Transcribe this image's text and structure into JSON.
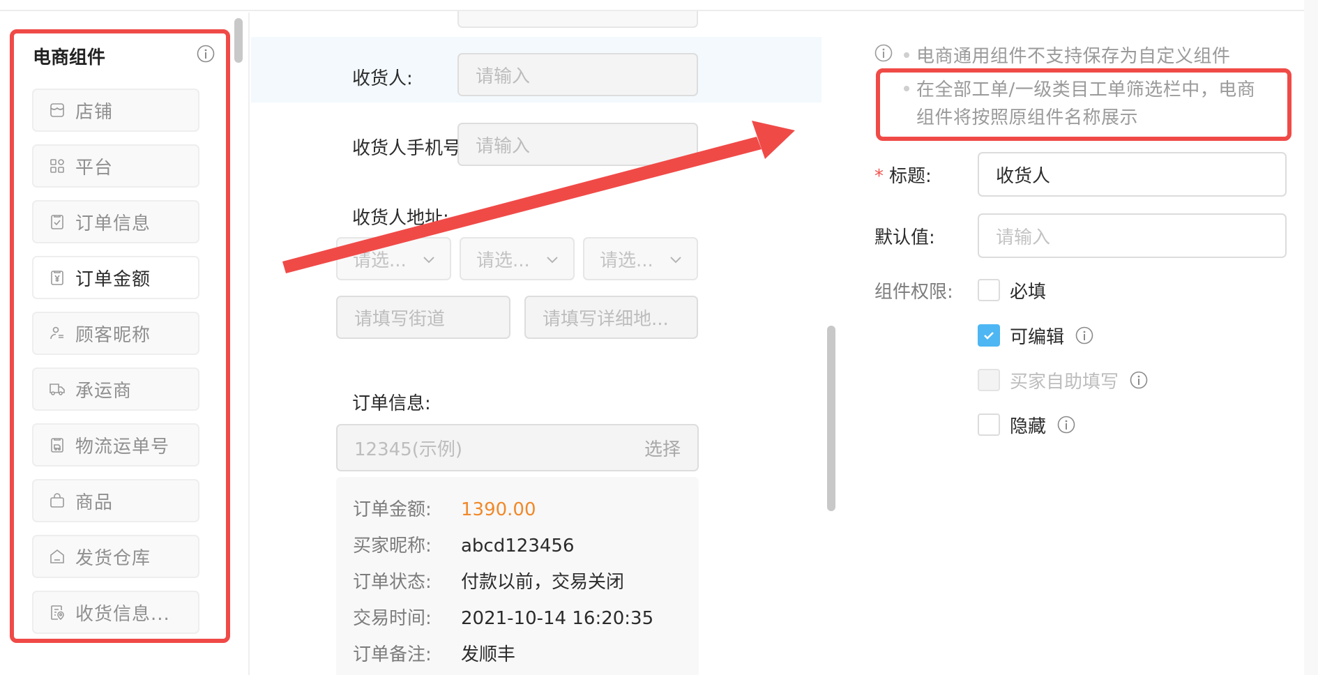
{
  "sidebar": {
    "title": "电商组件",
    "info_icon": "info-circle-icon",
    "items": [
      {
        "label": "店铺",
        "icon": "store-icon",
        "active": false
      },
      {
        "label": "平台",
        "icon": "grid-icon",
        "active": false
      },
      {
        "label": "订单信息",
        "icon": "clipboard-check-icon",
        "active": false
      },
      {
        "label": "订单金额",
        "icon": "yuan-receipt-icon",
        "active": true
      },
      {
        "label": "顾客昵称",
        "icon": "user-list-icon",
        "active": false
      },
      {
        "label": "承运商",
        "icon": "truck-icon",
        "active": false
      },
      {
        "label": "物流运单号",
        "icon": "delivery-doc-icon",
        "active": false
      },
      {
        "label": "商品",
        "icon": "shopping-bag-icon",
        "active": false
      },
      {
        "label": "发货仓库",
        "icon": "warehouse-icon",
        "active": false
      },
      {
        "label": "收货信息...",
        "icon": "address-doc-icon",
        "active": false
      }
    ]
  },
  "preview": {
    "consignee": {
      "label": "收货人:",
      "placeholder": "请输入"
    },
    "consignee_phone": {
      "label": "收货人手机号",
      "placeholder": "请输入"
    },
    "consignee_address": {
      "label": "收货人地址:",
      "selects": [
        "请选...",
        "请选...",
        "请选..."
      ],
      "street_placeholder": "请填写街道",
      "detail_placeholder": "请填写详细地..."
    },
    "order_info": {
      "label": "订单信息:",
      "input_placeholder": "12345(示例)",
      "select_button": "选择",
      "details": [
        {
          "key": "订单金额:",
          "value": "1390.00"
        },
        {
          "key": "买家昵称:",
          "value": "abcd123456"
        },
        {
          "key": "订单状态:",
          "value": "付款以前，交易关闭"
        },
        {
          "key": "交易时间:",
          "value": "2021-10-14 16:20:35"
        },
        {
          "key": "订单备注:",
          "value": "发顺丰"
        }
      ]
    }
  },
  "settings": {
    "tips": [
      "电商通用组件不支持保存为自定义组件",
      "在全部工单/一级类目工单筛选栏中，电商",
      "组件将按照原组件名称展示"
    ],
    "title_field": {
      "label": "标题:",
      "required_mark": "*",
      "value": "收货人"
    },
    "default_field": {
      "label": "默认值:",
      "placeholder": "请输入"
    },
    "permissions": {
      "label": "组件权限:",
      "options": [
        {
          "label": "必填",
          "checked": false,
          "disabled": false,
          "has_info": false
        },
        {
          "label": "可编辑",
          "checked": true,
          "disabled": false,
          "has_info": true
        },
        {
          "label": "买家自助填写",
          "checked": false,
          "disabled": true,
          "has_info": true
        },
        {
          "label": "隐藏",
          "checked": false,
          "disabled": false,
          "has_info": true
        }
      ]
    }
  },
  "colors": {
    "annotation_red": "#f04a47",
    "accent_blue": "#4db6f3",
    "amount_orange": "#f0892b",
    "highlight_row": "#f3f9fd"
  }
}
